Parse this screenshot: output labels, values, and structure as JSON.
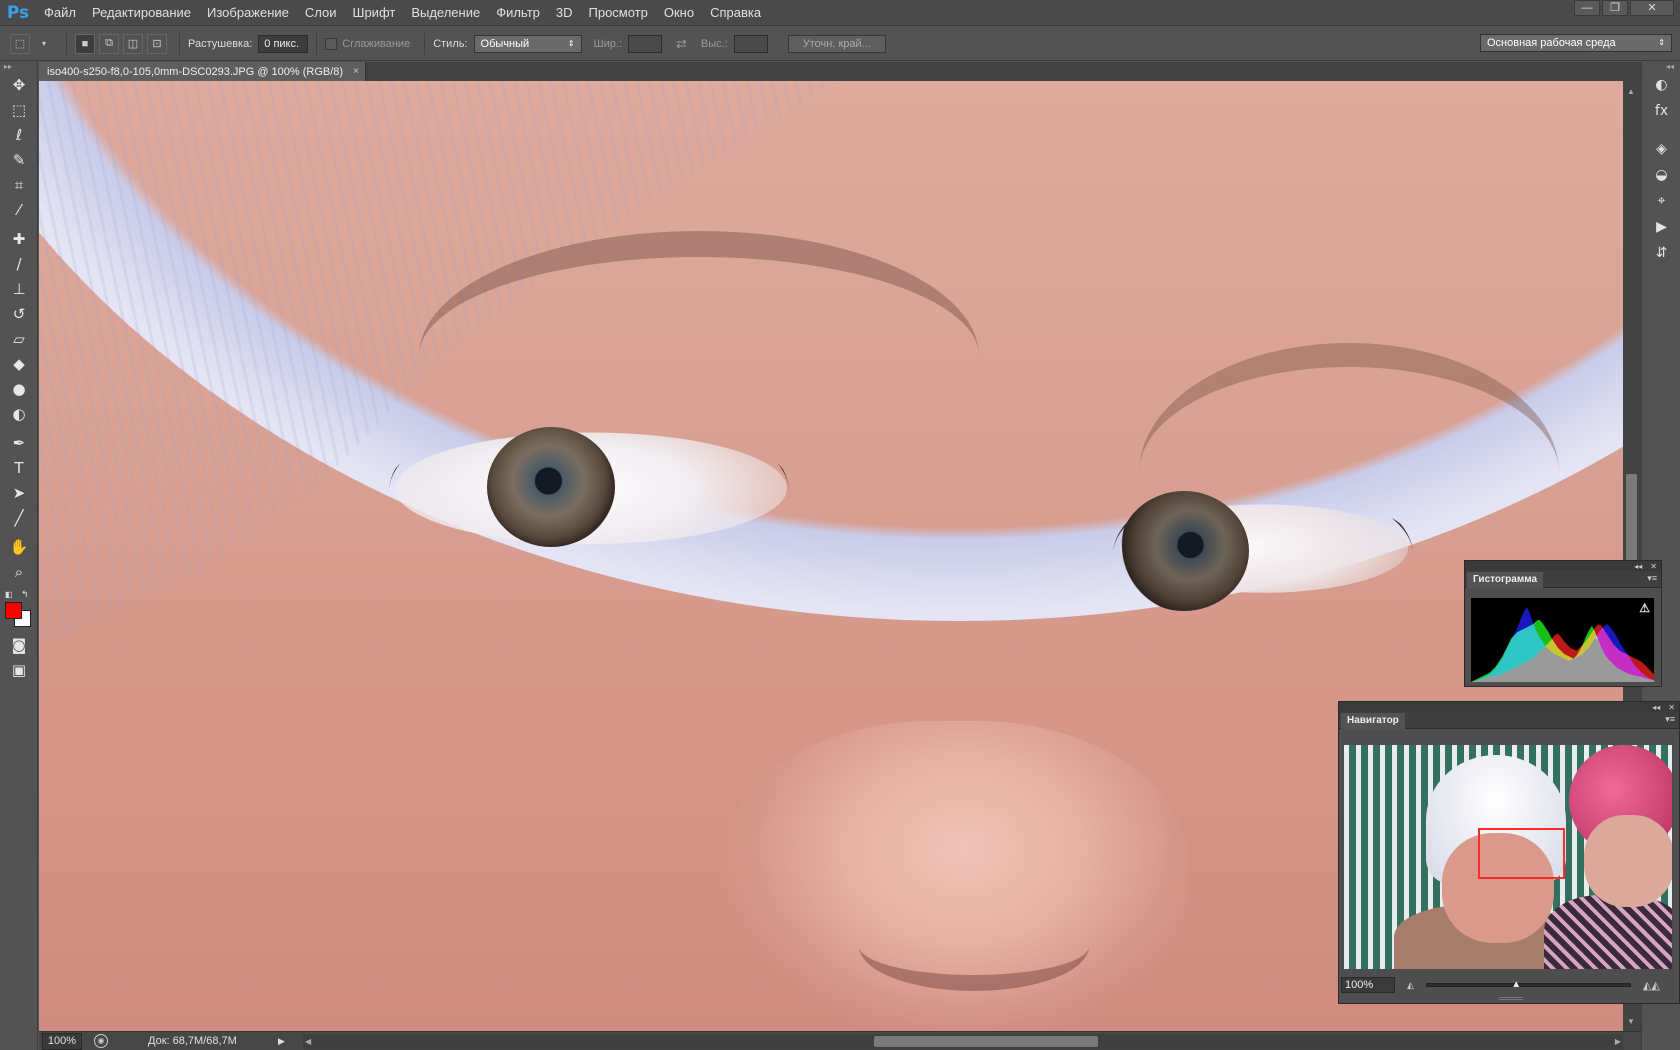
{
  "app": {
    "logo": "Ps"
  },
  "menu": [
    "Файл",
    "Редактирование",
    "Изображение",
    "Слои",
    "Шрифт",
    "Выделение",
    "Фильтр",
    "3D",
    "Просмотр",
    "Окно",
    "Справка"
  ],
  "window_controls": {
    "minimize": "—",
    "restore": "❐",
    "close": "✕"
  },
  "options": {
    "feather_label": "Растушевка:",
    "feather_value": "0 пикс.",
    "antialias_label": "Сглаживание",
    "style_label": "Стиль:",
    "style_value": "Обычный",
    "width_label": "Шир.:",
    "height_label": "Выс.:",
    "refine_edge": "Уточн. край...",
    "workspace": "Основная рабочая среда"
  },
  "document": {
    "tab_title": "iso400-s250-f8,0-105,0mm-DSC0293.JPG @ 100% (RGB/8)",
    "tab_close": "×"
  },
  "toolbar": {
    "tools": [
      {
        "name": "move-tool",
        "glyph": "✥"
      },
      {
        "name": "marquee-tool",
        "glyph": "⬚"
      },
      {
        "name": "lasso-tool",
        "glyph": "ℓ"
      },
      {
        "name": "quick-select-tool",
        "glyph": "✎"
      },
      {
        "name": "crop-tool",
        "glyph": "⌗"
      },
      {
        "name": "eyedropper-tool",
        "glyph": "⁄"
      },
      {
        "name": "healing-tool",
        "glyph": "✚"
      },
      {
        "name": "brush-tool",
        "glyph": "/"
      },
      {
        "name": "stamp-tool",
        "glyph": "⊥"
      },
      {
        "name": "history-brush-tool",
        "glyph": "↺"
      },
      {
        "name": "eraser-tool",
        "glyph": "▱"
      },
      {
        "name": "bucket-tool",
        "glyph": "◆"
      },
      {
        "name": "blur-tool",
        "glyph": "●"
      },
      {
        "name": "dodge-tool",
        "glyph": "◐"
      },
      {
        "name": "pen-tool",
        "glyph": "✒"
      },
      {
        "name": "type-tool",
        "glyph": "T"
      },
      {
        "name": "path-select-tool",
        "glyph": "➤"
      },
      {
        "name": "line-tool",
        "glyph": "╱"
      },
      {
        "name": "hand-tool",
        "glyph": "✋"
      },
      {
        "name": "zoom-tool",
        "glyph": "⌕"
      }
    ],
    "foreground_color": "#ff0000",
    "background_color": "#ffffff",
    "quick_mask_glyph": "◙",
    "screen_mode_glyph": "▣"
  },
  "dock": [
    "◐",
    "fx",
    "◈",
    "◒",
    "⌖",
    "▶",
    "⇵"
  ],
  "status": {
    "zoom": "100%",
    "doc_size": "Док: 68,7M/68,7M"
  },
  "histogram": {
    "title": "Гистограмма",
    "warning": "⚠",
    "series_colors": {
      "red": "#ff2020",
      "green": "#20ff20",
      "blue": "#2020ff",
      "cyan": "#00e0ff",
      "magenta": "#ff20ff",
      "yellow": "#ffff20",
      "gray": "#9a9a9a"
    },
    "channels": {
      "red": [
        0,
        1,
        2,
        3,
        4,
        5,
        6,
        7,
        8,
        9,
        10,
        12,
        14,
        16,
        18,
        20,
        22,
        24,
        26,
        28,
        30,
        34,
        38,
        42,
        46,
        50,
        55,
        60,
        62,
        58,
        52,
        48,
        44,
        42,
        40,
        44,
        48,
        52,
        58,
        64,
        70,
        74,
        72,
        66,
        60,
        54,
        48,
        44,
        40,
        38,
        36,
        34,
        32,
        30,
        28,
        26,
        22,
        18,
        14,
        10
      ],
      "green": [
        0,
        2,
        4,
        6,
        8,
        10,
        12,
        16,
        20,
        26,
        32,
        40,
        48,
        56,
        60,
        64,
        66,
        68,
        70,
        72,
        74,
        78,
        80,
        76,
        70,
        64,
        56,
        50,
        44,
        40,
        36,
        34,
        32,
        30,
        34,
        40,
        48,
        58,
        66,
        72,
        64,
        54,
        44,
        36,
        30,
        26,
        22,
        18,
        16,
        14,
        12,
        10,
        9,
        8,
        7,
        6,
        5,
        4,
        3,
        2
      ],
      "blue": [
        0,
        1,
        2,
        4,
        6,
        8,
        10,
        14,
        18,
        24,
        30,
        38,
        46,
        54,
        62,
        70,
        80,
        90,
        96,
        88,
        76,
        66,
        58,
        52,
        46,
        42,
        38,
        36,
        34,
        32,
        30,
        28,
        28,
        30,
        32,
        34,
        36,
        40,
        44,
        50,
        56,
        62,
        68,
        72,
        74,
        70,
        64,
        58,
        50,
        44,
        38,
        32,
        26,
        20,
        16,
        12,
        9,
        6,
        4,
        2
      ]
    }
  },
  "navigator": {
    "title": "Навигатор",
    "zoom": "100%",
    "zoom_level": 0.44
  }
}
